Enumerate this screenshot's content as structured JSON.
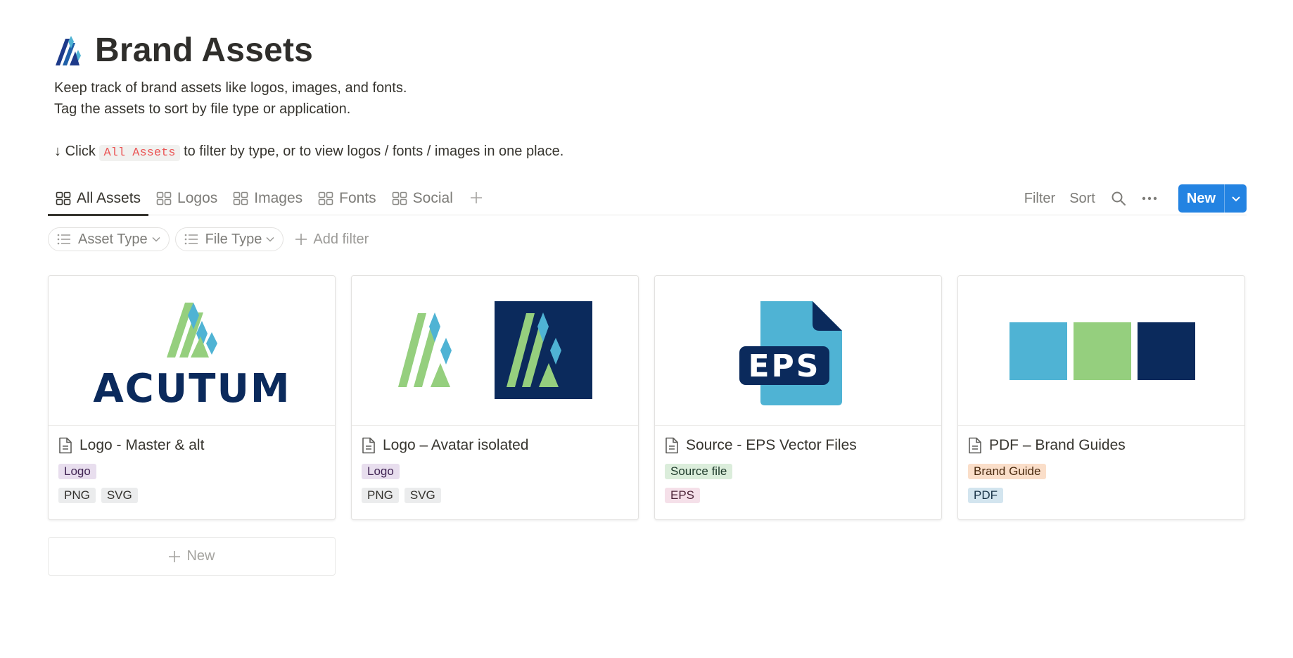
{
  "page": {
    "title": "Brand Assets",
    "description": [
      "Keep track of brand assets like logos, images, and fonts.",
      "Tag the assets to sort by file type or application."
    ],
    "hint": {
      "arrow": "↓",
      "prefix": "Click",
      "code": "All Assets",
      "suffix": "to filter by type, or to view logos / fonts / images in one place."
    }
  },
  "tabs": [
    {
      "label": "All Assets",
      "active": true
    },
    {
      "label": "Logos",
      "active": false
    },
    {
      "label": "Images",
      "active": false
    },
    {
      "label": "Fonts",
      "active": false
    },
    {
      "label": "Social",
      "active": false
    }
  ],
  "toolbar": {
    "filter_label": "Filter",
    "sort_label": "Sort",
    "new_label": "New"
  },
  "filters": [
    {
      "label": "Asset Type"
    },
    {
      "label": "File Type"
    }
  ],
  "add_filter_label": "Add filter",
  "cards": [
    {
      "title": "Logo - Master & alt",
      "type_tags": [
        "Logo"
      ],
      "file_tags": [
        "PNG",
        "SVG"
      ],
      "cover_text": "ACUTUM"
    },
    {
      "title": "Logo – Avatar isolated",
      "type_tags": [
        "Logo"
      ],
      "file_tags": [
        "PNG",
        "SVG"
      ]
    },
    {
      "title": "Source - EPS Vector Files",
      "type_tags": [
        "Source file"
      ],
      "file_tags": [
        "EPS"
      ],
      "cover_text": "EPS"
    },
    {
      "title": "PDF – Brand Guides",
      "type_tags": [
        "Brand Guide"
      ],
      "file_tags": [
        "PDF"
      ]
    }
  ],
  "new_card_label": "New",
  "colors": {
    "accent": "#2383e2",
    "brand_navy": "#0b2a5c",
    "brand_green": "#95cf7e",
    "brand_blue": "#4fb3d4"
  }
}
